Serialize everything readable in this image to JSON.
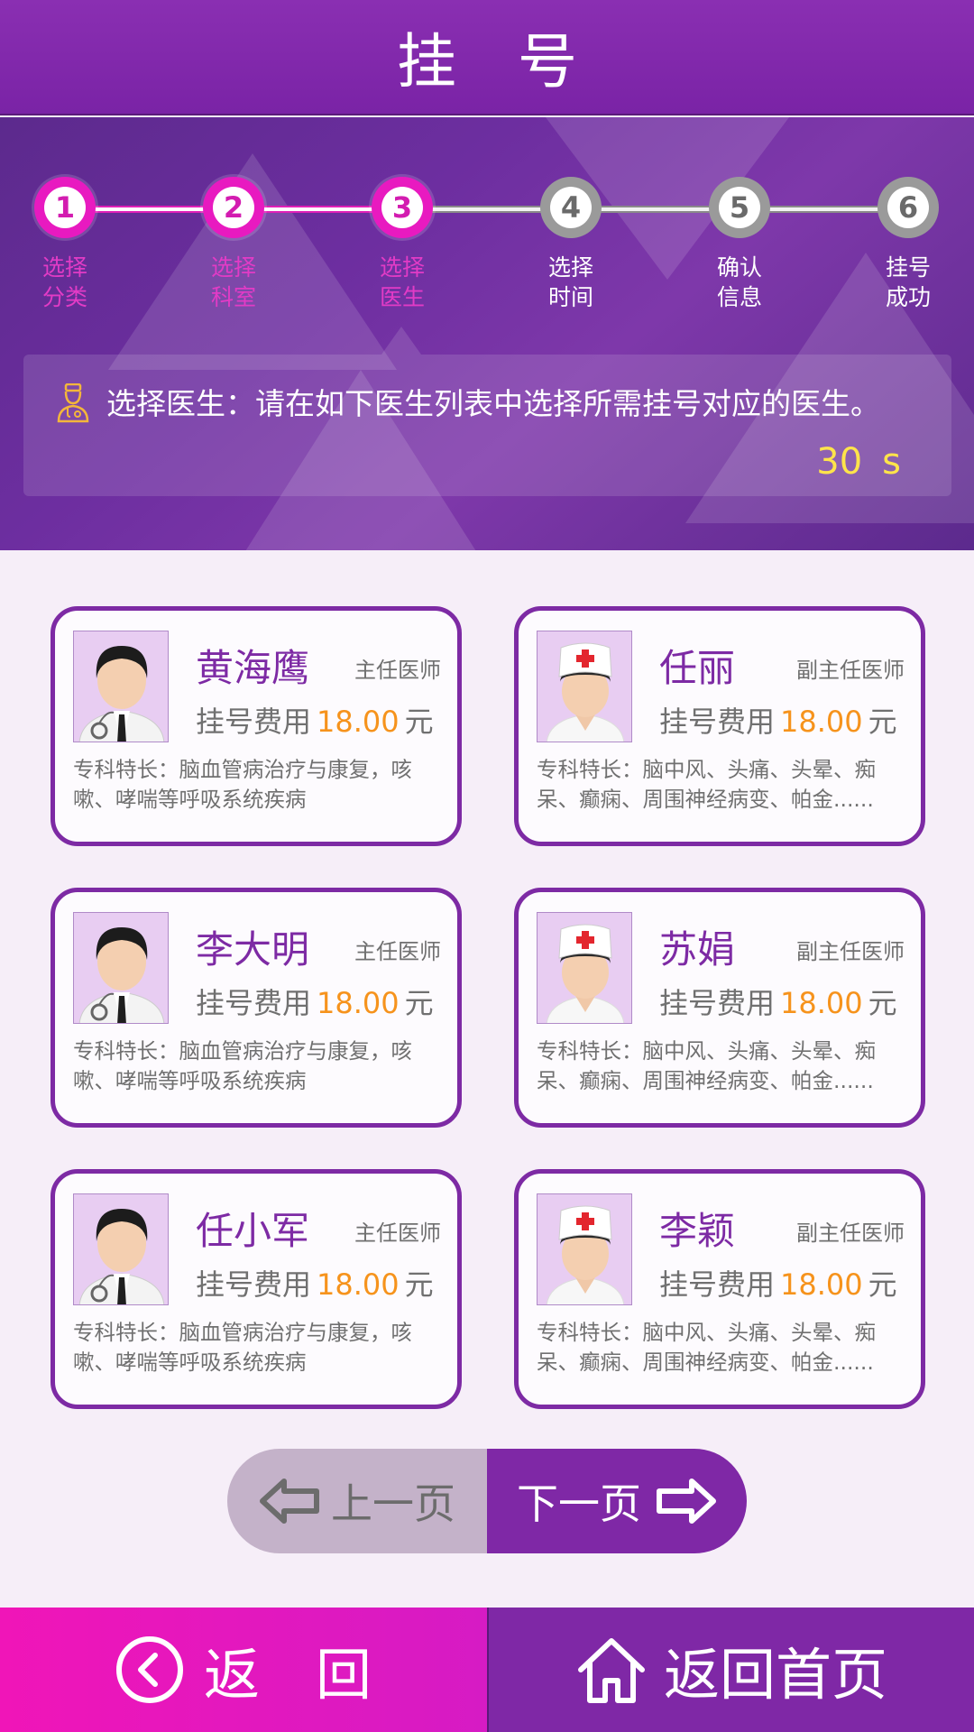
{
  "header": {
    "title": "挂号"
  },
  "steps": [
    {
      "num": "1",
      "label": "选择\n分类",
      "state": "done"
    },
    {
      "num": "2",
      "label": "选择\n科室",
      "state": "done"
    },
    {
      "num": "3",
      "label": "选择\n医生",
      "state": "done"
    },
    {
      "num": "4",
      "label": "选择\n时间",
      "state": "todo"
    },
    {
      "num": "5",
      "label": "确认\n信息",
      "state": "todo"
    },
    {
      "num": "6",
      "label": "挂号\n成功",
      "state": "todo"
    }
  ],
  "notice": {
    "message": "选择医生：请在如下医生列表中选择所需挂号对应的医生。",
    "timer_value": "30",
    "timer_unit": "s"
  },
  "doctors": [
    {
      "name": "黄海鹰",
      "title": "主任医师",
      "fee_label": "挂号费用",
      "fee": "18.00",
      "fee_unit": "元",
      "specialty": "专科特长：脑血管病治疗与康复，咳嗽、哮喘等呼吸系统疾病",
      "avatar": "male-doctor-icon"
    },
    {
      "name": "任丽",
      "title": "副主任医师",
      "fee_label": "挂号费用",
      "fee": "18.00",
      "fee_unit": "元",
      "specialty": "专科特长：脑中风、头痛、头晕、痴呆、癫痫、周围神经病变、帕金......",
      "avatar": "female-nurse-icon"
    },
    {
      "name": "李大明",
      "title": "主任医师",
      "fee_label": "挂号费用",
      "fee": "18.00",
      "fee_unit": "元",
      "specialty": "专科特长：脑血管病治疗与康复，咳嗽、哮喘等呼吸系统疾病",
      "avatar": "male-doctor-icon"
    },
    {
      "name": "苏娟",
      "title": "副主任医师",
      "fee_label": "挂号费用",
      "fee": "18.00",
      "fee_unit": "元",
      "specialty": "专科特长：脑中风、头痛、头晕、痴呆、癫痫、周围神经病变、帕金......",
      "avatar": "female-nurse-icon"
    },
    {
      "name": "任小军",
      "title": "主任医师",
      "fee_label": "挂号费用",
      "fee": "18.00",
      "fee_unit": "元",
      "specialty": "专科特长：脑血管病治疗与康复，咳嗽、哮喘等呼吸系统疾病",
      "avatar": "male-doctor-icon"
    },
    {
      "name": "李颖",
      "title": "副主任医师",
      "fee_label": "挂号费用",
      "fee": "18.00",
      "fee_unit": "元",
      "specialty": "专科特长：脑中风、头痛、头晕、痴呆、癫痫、周围神经病变、帕金......",
      "avatar": "female-nurse-icon"
    }
  ],
  "pager": {
    "prev_label": "上一页",
    "next_label": "下一页"
  },
  "bottom": {
    "back_label": "返回",
    "home_label": "返回首页"
  },
  "colors": {
    "primary": "#7f28a6",
    "accent": "#e81ac0",
    "fee": "#f6931c",
    "timer": "#ffe44a"
  }
}
